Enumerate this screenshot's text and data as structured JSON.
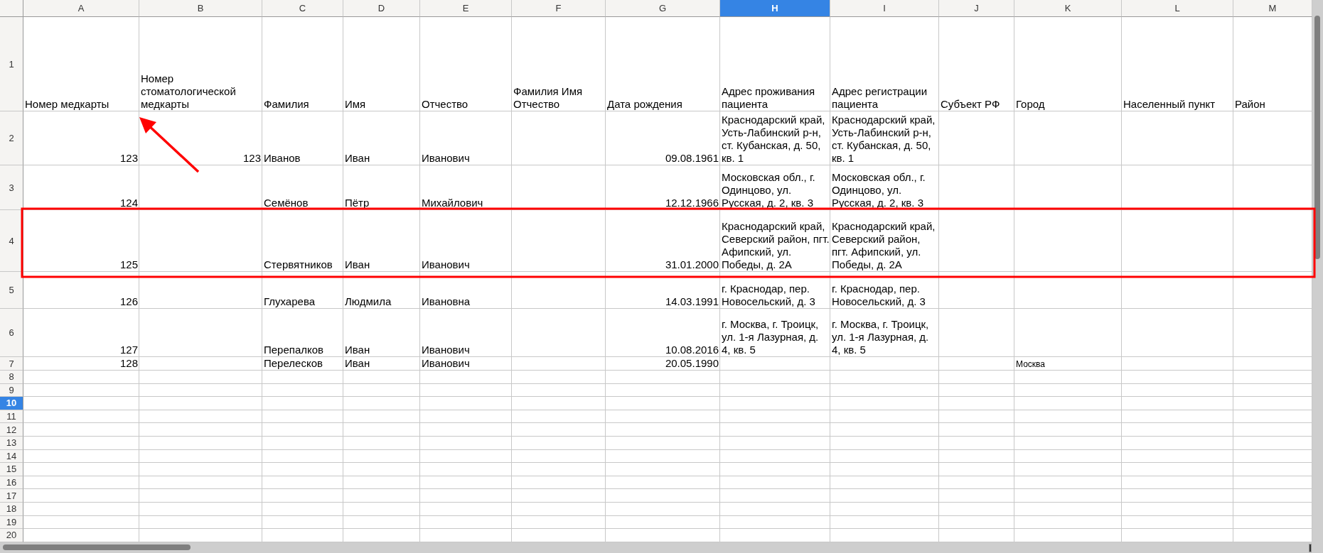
{
  "columns": [
    {
      "label": "A",
      "selected": false
    },
    {
      "label": "B",
      "selected": false
    },
    {
      "label": "C",
      "selected": false
    },
    {
      "label": "D",
      "selected": false
    },
    {
      "label": "E",
      "selected": false
    },
    {
      "label": "F",
      "selected": false
    },
    {
      "label": "G",
      "selected": false
    },
    {
      "label": "H",
      "selected": true
    },
    {
      "label": "I",
      "selected": false
    },
    {
      "label": "J",
      "selected": false
    },
    {
      "label": "K",
      "selected": false
    },
    {
      "label": "L",
      "selected": false
    },
    {
      "label": "M",
      "selected": false
    }
  ],
  "rows": [
    {
      "label": "1",
      "selected": false,
      "cells": {
        "A": {
          "text": "Номер медкарты",
          "kind": "text"
        },
        "B": {
          "text": "Номер стоматологической медкарты",
          "kind": "text"
        },
        "C": {
          "text": "Фамилия",
          "kind": "text"
        },
        "D": {
          "text": "Имя",
          "kind": "text"
        },
        "E": {
          "text": "Отчество",
          "kind": "text"
        },
        "F": {
          "text": "Фамилия Имя Отчество",
          "kind": "text"
        },
        "G": {
          "text": "Дата рождения",
          "kind": "text"
        },
        "H": {
          "text": "Адрес проживания пациента",
          "kind": "text"
        },
        "I": {
          "text": "Адрес регистрации пациента",
          "kind": "text"
        },
        "J": {
          "text": "Субъект РФ",
          "kind": "text"
        },
        "K": {
          "text": "Город",
          "kind": "text"
        },
        "L": {
          "text": "Населенный пункт",
          "kind": "text"
        },
        "M": {
          "text": "Район",
          "kind": "text"
        }
      }
    },
    {
      "label": "2",
      "selected": false,
      "cells": {
        "A": {
          "text": "123",
          "kind": "number"
        },
        "B": {
          "text": "123",
          "kind": "number"
        },
        "C": {
          "text": "Иванов",
          "kind": "text"
        },
        "D": {
          "text": "Иван",
          "kind": "text"
        },
        "E": {
          "text": "Иванович",
          "kind": "text"
        },
        "G": {
          "text": "09.08.1961",
          "kind": "number"
        },
        "H": {
          "text": "Краснодарский край, Усть-Лабинский р-н, ст. Кубанская, д. 50, кв. 1",
          "kind": "text"
        },
        "I": {
          "text": "Краснодарский край, Усть-Лабинский р-н, ст. Кубанская, д. 50, кв. 1",
          "kind": "text"
        }
      }
    },
    {
      "label": "3",
      "selected": false,
      "cells": {
        "A": {
          "text": "124",
          "kind": "number"
        },
        "C": {
          "text": "Семёнов",
          "kind": "text"
        },
        "D": {
          "text": "Пётр",
          "kind": "text"
        },
        "E": {
          "text": "Михайлович",
          "kind": "text"
        },
        "G": {
          "text": "12.12.1966",
          "kind": "number"
        },
        "H": {
          "text": "Московская обл., г. Одинцово, ул. Русская, д. 2, кв. 3",
          "kind": "text"
        },
        "I": {
          "text": "Московская обл., г. Одинцово, ул. Русская, д. 2, кв. 3",
          "kind": "text"
        }
      }
    },
    {
      "label": "4",
      "selected": false,
      "cells": {
        "A": {
          "text": "125",
          "kind": "number"
        },
        "C": {
          "text": "Стервятников",
          "kind": "text"
        },
        "D": {
          "text": "Иван",
          "kind": "text"
        },
        "E": {
          "text": "Иванович",
          "kind": "text"
        },
        "G": {
          "text": "31.01.2000",
          "kind": "number"
        },
        "H": {
          "text": "Краснодарский край, Северский район, пгт. Афипский, ул. Победы, д. 2А",
          "kind": "text"
        },
        "I": {
          "text": "Краснодарский край, Северский район, пгт. Афипский, ул. Победы, д. 2А",
          "kind": "text"
        }
      }
    },
    {
      "label": "5",
      "selected": false,
      "cells": {
        "A": {
          "text": "126",
          "kind": "number"
        },
        "C": {
          "text": "Глухарева",
          "kind": "text"
        },
        "D": {
          "text": "Людмила",
          "kind": "text"
        },
        "E": {
          "text": "Ивановна",
          "kind": "text"
        },
        "G": {
          "text": "14.03.1991",
          "kind": "number"
        },
        "H": {
          "text": "г. Краснодар, пер. Новосельский, д. 3",
          "kind": "text"
        },
        "I": {
          "text": "г. Краснодар, пер. Новосельский, д. 3",
          "kind": "text"
        }
      }
    },
    {
      "label": "6",
      "selected": false,
      "cells": {
        "A": {
          "text": "127",
          "kind": "number"
        },
        "C": {
          "text": "Перепалков",
          "kind": "text"
        },
        "D": {
          "text": "Иван",
          "kind": "text"
        },
        "E": {
          "text": "Иванович",
          "kind": "text"
        },
        "G": {
          "text": "10.08.2016",
          "kind": "number"
        },
        "H": {
          "text": "г. Москва, г. Троицк, ул. 1-я Лазурная, д. 4, кв. 5",
          "kind": "text"
        },
        "I": {
          "text": "г. Москва, г. Троицк, ул. 1-я Лазурная, д. 4, кв. 5",
          "kind": "text"
        }
      }
    },
    {
      "label": "7",
      "selected": false,
      "cells": {
        "A": {
          "text": "128",
          "kind": "number"
        },
        "C": {
          "text": "Перелесков",
          "kind": "text"
        },
        "D": {
          "text": "Иван",
          "kind": "text"
        },
        "E": {
          "text": "Иванович",
          "kind": "text"
        },
        "G": {
          "text": "20.05.1990",
          "kind": "number"
        },
        "K": {
          "text": "Москва",
          "kind": "small_text"
        }
      }
    },
    {
      "label": "8",
      "selected": false
    },
    {
      "label": "9",
      "selected": false
    },
    {
      "label": "10",
      "selected": true
    },
    {
      "label": "11",
      "selected": false
    },
    {
      "label": "12",
      "selected": false
    },
    {
      "label": "13",
      "selected": false
    },
    {
      "label": "14",
      "selected": false
    },
    {
      "label": "15",
      "selected": false
    },
    {
      "label": "16",
      "selected": false
    },
    {
      "label": "17",
      "selected": false
    },
    {
      "label": "18",
      "selected": false
    },
    {
      "label": "19",
      "selected": false
    },
    {
      "label": "20",
      "selected": false
    }
  ]
}
